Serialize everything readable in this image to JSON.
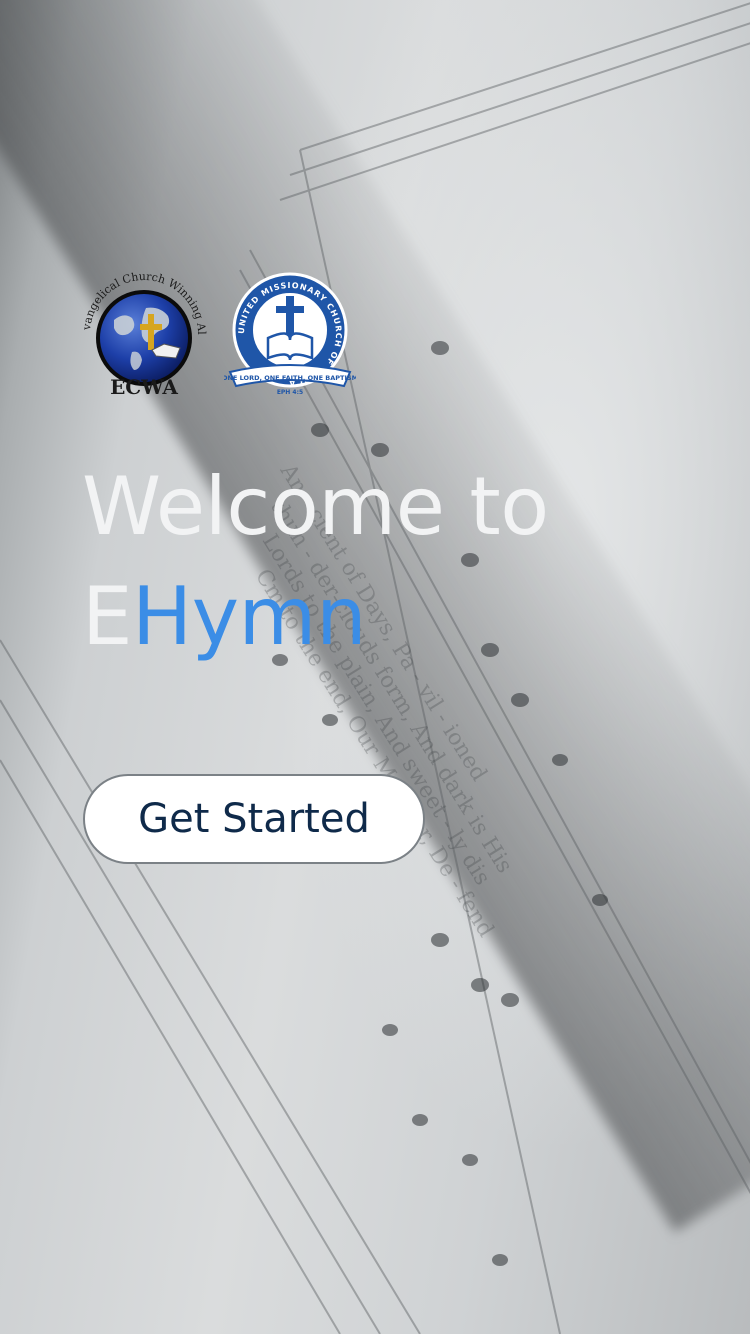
{
  "background": {
    "icon": "sheet-music-background"
  },
  "logos": {
    "ecwa": {
      "icon": "globe-cross-icon",
      "arc_text": "Evangelical Church Winning All",
      "name": "ECWA"
    },
    "umca": {
      "icon": "cross-bible-icon",
      "ring_text": "UNITED MISSIONARY CHURCH OF AFRICA",
      "ribbon_text": "ONE LORD, ONE FAITH, ONE BAPTISM",
      "ribbon_ref": "EPH 4:5"
    }
  },
  "headline": {
    "line1": "Welcome to",
    "prefix": "E",
    "highlight": "Hymn"
  },
  "cta": {
    "label": "Get Started"
  },
  "colors": {
    "accent": "#3b8de6",
    "headline": "#f2f3f4",
    "button_text": "#0f2a4a"
  }
}
